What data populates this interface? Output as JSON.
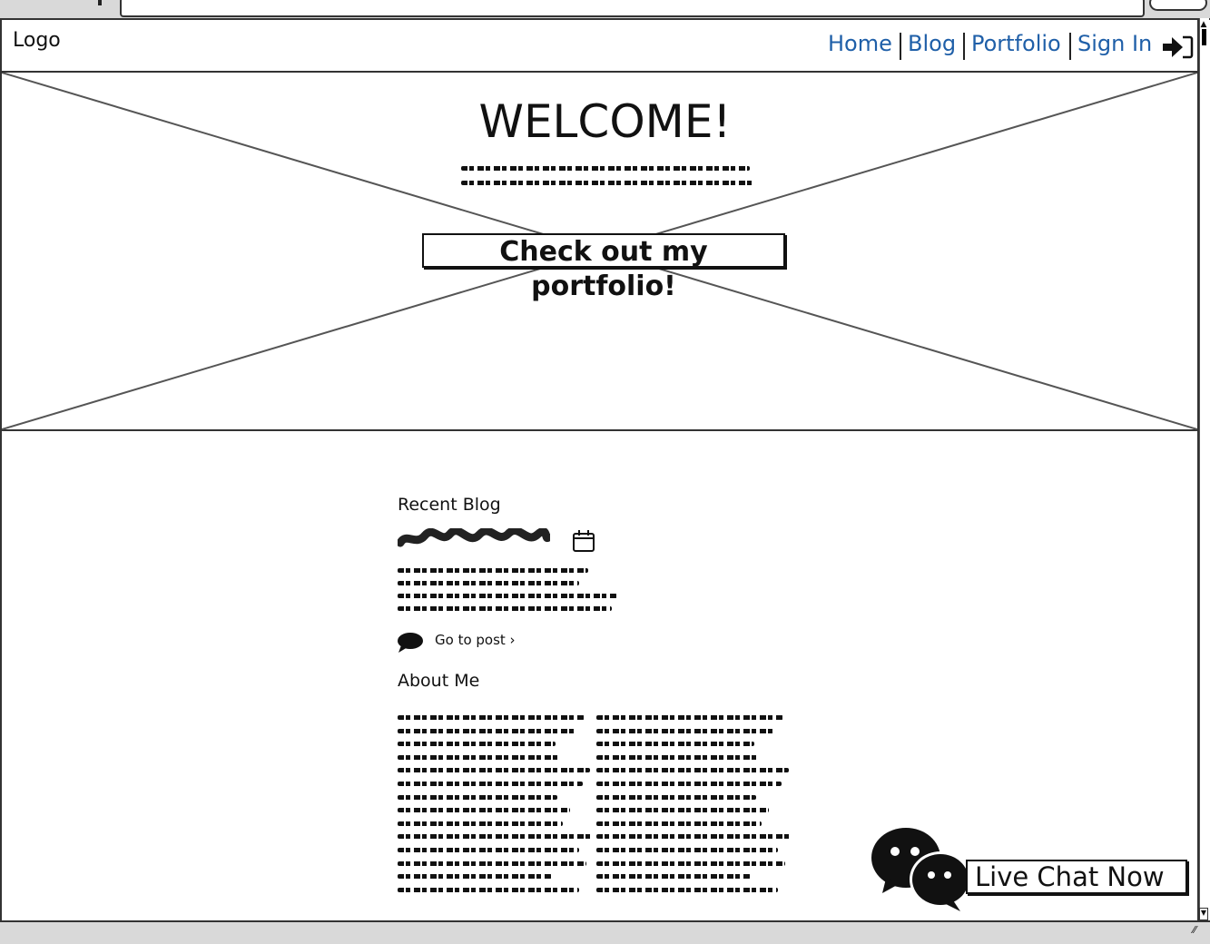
{
  "header": {
    "logo": "Logo",
    "nav": [
      {
        "label": "Home"
      },
      {
        "label": "Blog"
      },
      {
        "label": "Portfolio"
      },
      {
        "label": "Sign In"
      }
    ],
    "link_color": "#1f5fa8"
  },
  "hero": {
    "title": "WELCOME!",
    "cta_label": "Check out my portfolio!"
  },
  "recent_blog": {
    "heading": "Recent Blog",
    "go_to_post": "Go to post ›"
  },
  "about": {
    "heading": "About Me"
  },
  "chat": {
    "label": "Live Chat Now"
  },
  "icons": {
    "sign_in": "sign-in-arrow-icon",
    "calendar": "calendar-icon",
    "comment": "speech-bubble-icon",
    "chat": "wechat-style-chat-icon"
  }
}
